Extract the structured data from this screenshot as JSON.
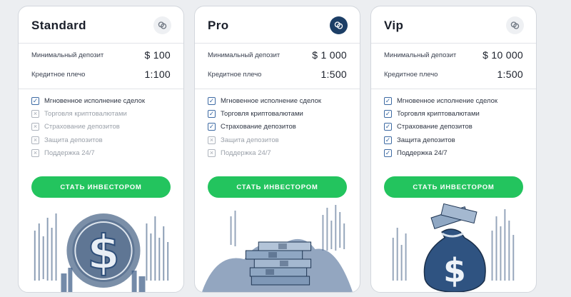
{
  "plans": [
    {
      "name": "Standard",
      "badge_icon": "link-rings-icon",
      "badge_active": false,
      "details": [
        {
          "label": "Минимальный депозит",
          "value": "$ 100"
        },
        {
          "label": "Кредитное плечо",
          "value": "1:100"
        }
      ],
      "features": [
        {
          "label": "Мгновенное исполнение сделок",
          "included": true
        },
        {
          "label": "Торговля криптовалютами",
          "included": false
        },
        {
          "label": "Страхование депозитов",
          "included": false
        },
        {
          "label": "Защита депозитов",
          "included": false
        },
        {
          "label": "Поддержка 24/7",
          "included": false
        }
      ],
      "cta_label": "СТАТЬ ИНВЕСТОРОМ",
      "illustration": "dollar-coin-illustration"
    },
    {
      "name": "Pro",
      "badge_icon": "link-rings-icon",
      "badge_active": true,
      "details": [
        {
          "label": "Минимальный депозит",
          "value": "$ 1 000"
        },
        {
          "label": "Кредитное плечо",
          "value": "1:500"
        }
      ],
      "features": [
        {
          "label": "Мгновенное исполнение сделок",
          "included": true
        },
        {
          "label": "Торговля криптовалютами",
          "included": true
        },
        {
          "label": "Страхование депозитов",
          "included": true
        },
        {
          "label": "Защита депозитов",
          "included": false
        },
        {
          "label": "Поддержка 24/7",
          "included": false
        }
      ],
      "cta_label": "СТАТЬ ИНВЕСТОРОМ",
      "illustration": "cash-stacks-illustration"
    },
    {
      "name": "Vip",
      "badge_icon": "link-rings-icon",
      "badge_active": false,
      "details": [
        {
          "label": "Минимальный депозит",
          "value": "$ 10 000"
        },
        {
          "label": "Кредитное плечо",
          "value": "1:500"
        }
      ],
      "features": [
        {
          "label": "Мгновенное исполнение сделок",
          "included": true
        },
        {
          "label": "Торговля криптовалютами",
          "included": true
        },
        {
          "label": "Страхование депозитов",
          "included": true
        },
        {
          "label": "Защита депозитов",
          "included": true
        },
        {
          "label": "Поддержка 24/7",
          "included": true
        }
      ],
      "cta_label": "СТАТЬ ИНВЕСТОРОМ",
      "illustration": "money-bag-illustration"
    }
  ],
  "colors": {
    "accent_green": "#23c45e",
    "brand_navy": "#1c3e66",
    "check_blue": "#3d6aa3"
  }
}
